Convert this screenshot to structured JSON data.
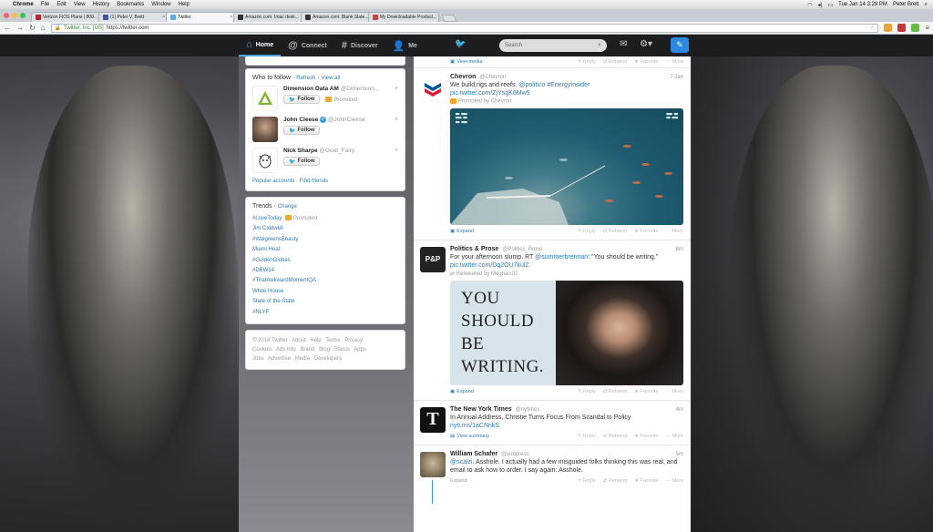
{
  "os_menu": {
    "app": "Chrome",
    "items": [
      "File",
      "Edit",
      "View",
      "History",
      "Bookmarks",
      "Window",
      "Help"
    ],
    "clock": "Tue Jan 14  3:29 PM",
    "user": "Peter Brett"
  },
  "browser": {
    "tabs": [
      {
        "label": "Verizon FiOS Plans | 800...",
        "color": "#cc2222"
      },
      {
        "label": "(1) Peter V. Brett",
        "color": "#3b5998"
      },
      {
        "label": "Twitter",
        "color": "#55acee",
        "active": true
      },
      {
        "label": "Amazon.com: Imac desk...",
        "color": "#333333"
      },
      {
        "label": "Amazon.com: Blank Slate...",
        "color": "#333333"
      },
      {
        "label": "My Downloadable Product...",
        "color": "#d04040"
      }
    ],
    "ev_cert": "Twitter, Inc. [US]",
    "url": "https://twitter.com"
  },
  "twitter_nav": {
    "home": "Home",
    "connect": "Connect",
    "discover": "Discover",
    "me": "Me",
    "search_placeholder": "Search"
  },
  "who_to_follow": {
    "title": "Who to follow",
    "refresh": "Refresh",
    "view_all": "View all",
    "separator": "·",
    "follow_label": "Follow",
    "promoted_label": "Promoted",
    "users": [
      {
        "name": "Dimension Data AM",
        "handle": "@Dimension...",
        "promoted": true
      },
      {
        "name": "John Cleese",
        "handle": "@JohnCleese",
        "verified": true
      },
      {
        "name": "Nick Sharpe",
        "handle": "@Goat_Fairy"
      }
    ],
    "footer_popular": "Popular accounts",
    "footer_find": "Find friends"
  },
  "trends": {
    "title": "Trends",
    "change": "Change",
    "promoted_label": "Promoted",
    "items": [
      "#LoveToday",
      "Jim Caldwell",
      "#WalgreensBeauty",
      "Miami Heat",
      "#GoldenGlobes",
      "#DBW14",
      "#ThatAwkwardMomentQA",
      "White House",
      "State of the State",
      "#NLYF"
    ]
  },
  "footer_links": [
    "© 2014 Twitter",
    "About",
    "Help",
    "Terms",
    "Privacy",
    "Cookies",
    "Ads info",
    "Brand",
    "Blog",
    "Status",
    "Apps",
    "Jobs",
    "Advertise",
    "Media",
    "Developers"
  ],
  "tweet_actions": {
    "reply": "Reply",
    "retweet": "Retweet",
    "favorite": "Favorite",
    "more": "More"
  },
  "tweets": [
    {
      "name": "Chevron",
      "handle": "@Chevron",
      "time": "7 Jan",
      "text_plain": "We build rigs and reefs. ",
      "links": [
        "@politico",
        "#EnergyInsider",
        "pic.twitter.com/ZjYsgK6Mw5"
      ],
      "meta": "Promoted by Chevron",
      "expand": "Expand"
    },
    {
      "name": "Politics & Prose",
      "handle": "@Politics_Prose",
      "time": "8m",
      "text_1": "For your afternoon slump. RT ",
      "mention": "@summerbrennan",
      "text_2": ": \"You should be writing.\" ",
      "link": "pic.twitter.com/Dq2OU7kulZ",
      "meta": "Retweeted by MeghanJG",
      "image_text": [
        "YOU",
        "SHOULD",
        "BE",
        "WRITING."
      ],
      "expand": "Expand"
    },
    {
      "name": "The New York Times",
      "handle": "@nytimes",
      "time": "4m",
      "text": "In Annual Address, Christie Turns Focus From Scandal to Policy",
      "link": "nyti.ms/1aCNnkS",
      "view_summary": "View summary"
    },
    {
      "name": "William Schafer",
      "handle": "@subpress",
      "time": "5m",
      "mention": "@scalzi",
      "text": ". Asshole. I actually had a few misguided folks thinking this was real, and email to ask how to order. I say again: Asshole.",
      "expand": "Expand"
    }
  ],
  "view_media": "View media",
  "colors": {
    "link": "#2b7bb9",
    "topbar": "#1d1d1f",
    "compose": "#2b8ae0"
  }
}
